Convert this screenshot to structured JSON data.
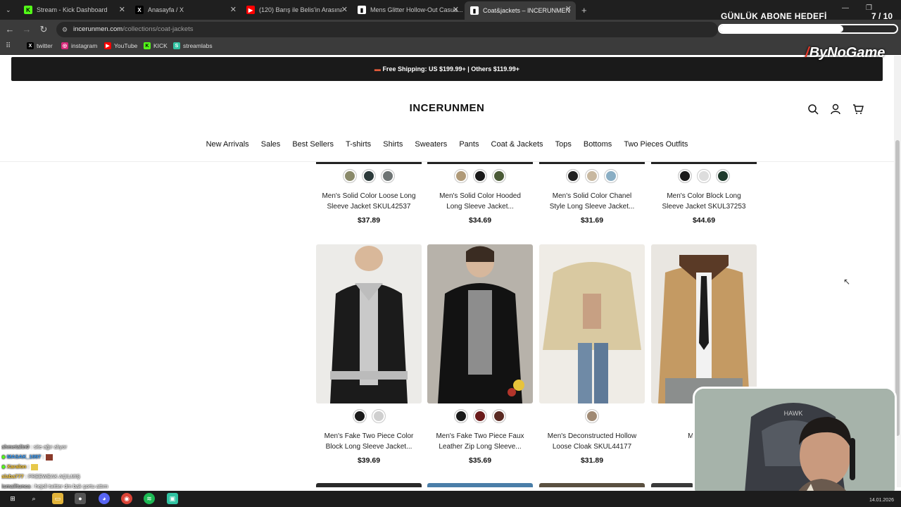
{
  "browser": {
    "tabs": [
      {
        "title": "Stream - Kick Dashboard",
        "icon": "kick-icon",
        "color": "#53fc18"
      },
      {
        "title": "Anasayfa / X",
        "icon": "x-icon",
        "color": "#000000"
      },
      {
        "title": "(120) Barış ile Belis'in Arasına G...",
        "icon": "youtube-icon",
        "color": "#ff0000"
      },
      {
        "title": "Mens Glitter Hollow-Out Casua...",
        "icon": "page-icon",
        "color": "#ffffff"
      },
      {
        "title": "Coat&jackets – INCERUNMEN",
        "icon": "page-icon",
        "color": "#ffffff"
      }
    ],
    "new_tab": "+",
    "url_host": "incerunmen.com",
    "url_path": "/collections/coat-jackets",
    "bookmarks": [
      {
        "label": "twitter",
        "icon": "x-icon"
      },
      {
        "label": "instagram",
        "icon": "instagram-icon"
      },
      {
        "label": "YouTube",
        "icon": "youtube-icon"
      },
      {
        "label": "KICK",
        "icon": "kick-icon"
      },
      {
        "label": "streamlabs",
        "icon": "streamlabs-icon"
      }
    ]
  },
  "overlay": {
    "goal_title": "GÜNLÜK ABONE HEDEFİ",
    "goal_count": "7 / 10",
    "goal_progress": 0.7,
    "logo_text": "ByNoGame"
  },
  "store": {
    "shipping_banner": "Free Shipping: US $199.99+ | Others $119.99+",
    "brand": "INCERUNMEN",
    "nav": [
      "New Arrivals",
      "Sales",
      "Best Sellers",
      "T-shirts",
      "Shirts",
      "Sweaters",
      "Pants",
      "Coat & Jackets",
      "Tops",
      "Bottoms",
      "Two Pieces Outfits"
    ],
    "products_row1": [
      {
        "title_line1": "Men's Solid Color Loose Long",
        "title_line2": "Sleeve Jacket SKUL42537",
        "price": "$37.89",
        "swatches": [
          "#8a8a6a",
          "#2c3a3a",
          "#6e7474"
        ]
      },
      {
        "title_line1": "Men's Solid Color Hooded",
        "title_line2": "Long Sleeve Jacket...",
        "price": "$34.69",
        "swatches": [
          "#b09a78",
          "#1a1a1a",
          "#4a5a36"
        ]
      },
      {
        "title_line1": "Men's Solid Color Chanel",
        "title_line2": "Style Long Sleeve Jacket...",
        "price": "$31.69",
        "swatches": [
          "#222222",
          "#c8b8a0",
          "#8aaec4"
        ]
      },
      {
        "title_line1": "Men's Color Block Long",
        "title_line2": "Sleeve Jacket SKUL37253",
        "price": "$44.69",
        "swatches": [
          "#1a1a1a",
          "#dddddd",
          "#1f3a2c"
        ]
      }
    ],
    "products_row2": [
      {
        "title_line1": "Men's Fake Two Piece Color",
        "title_line2": "Block Long Sleeve Jacket...",
        "price": "$39.69",
        "swatches": [
          "#1a1a1a",
          "#cfcfcf"
        ],
        "image": "black-jacket-image"
      },
      {
        "title_line1": "Men's Fake Two Piece Faux",
        "title_line2": "Leather Zip Long Sleeve...",
        "price": "$35.69",
        "swatches": [
          "#1a1a1a",
          "#6a1a1a",
          "#5a2a22"
        ],
        "image": "leather-jacket-image"
      },
      {
        "title_line1": "Men's Deconstructed Hollow",
        "title_line2": "Loose Cloak SKUL44177",
        "price": "$31.89",
        "swatches": [
          "#a08a74"
        ],
        "image": "beige-cloak-image"
      },
      {
        "title_line1": "Men's Soli",
        "title_line2": "Long S",
        "price": "",
        "swatches": [
          "#b8925a"
        ],
        "image": "tan-jacket-image"
      }
    ]
  },
  "chat": [
    {
      "user": "ahmetaltn0",
      "msg": ": site ağır alıyor"
    },
    {
      "user": "MASAK_1997",
      "msg": ":"
    },
    {
      "user": "Xaralon",
      "msg": ":"
    },
    {
      "user": "alaba777",
      "msg": ": FREEWEAK AÇILMIŞ"
    },
    {
      "user": "ismailtunca",
      "msg": ": hejoli twitter dm bak şortu attım"
    }
  ],
  "taskbar": {
    "date": "14.01.2026"
  }
}
